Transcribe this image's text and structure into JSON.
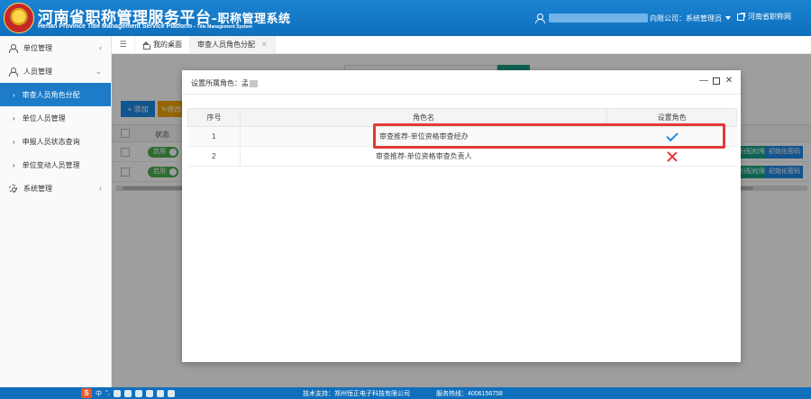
{
  "header": {
    "title_cn_main": "河南省职称管理服务平台",
    "title_cn_sub": "–职称管理系统",
    "title_en_main": "Henan Province Title Management Service Platform",
    "title_en_sub": " – Title Management System",
    "user_role": "向限公司：系统管理员",
    "portal_link": "河南省职称网"
  },
  "sidebar": {
    "items": [
      {
        "label": "单位管理"
      },
      {
        "label": "人员管理"
      },
      {
        "label": "审查人员角色分配"
      },
      {
        "label": "单位人员管理"
      },
      {
        "label": "申报人员状态查询"
      },
      {
        "label": "单位变动人员管理"
      },
      {
        "label": "系统管理"
      }
    ]
  },
  "tabs": [
    {
      "label": "我的桌面"
    },
    {
      "label": "审查人员角色分配"
    }
  ],
  "background": {
    "add_button": "添加",
    "edit_button": "修改",
    "status_header": "状态",
    "toggle_label": "启用",
    "action_a": "分配权限",
    "action_b": "初始化密码"
  },
  "modal": {
    "title_prefix": "设置所属角色：孟",
    "columns": [
      "序号",
      "角色名",
      "设置角色"
    ],
    "rows": [
      {
        "index": "1",
        "role": "审查推荐-单位资格审查经办",
        "assigned": true
      },
      {
        "index": "2",
        "role": "审查推荐-单位资格审查负责人",
        "assigned": false
      }
    ]
  },
  "footer": {
    "support": "技术支持：郑州恒正电子科技有限公司",
    "hotline": "服务热线：4006156758",
    "ime_labels": [
      "中",
      "°,",
      "☺",
      "🎤",
      "⌨",
      "👤",
      "👕",
      "▦"
    ]
  },
  "colors": {
    "header_blue": "#1a83d2",
    "sidebar_active": "#1d7bc8",
    "check_blue": "#1e88e5",
    "cross_red": "#e53935",
    "highlight_red": "#e53935",
    "toggle_green": "#4caf50"
  }
}
